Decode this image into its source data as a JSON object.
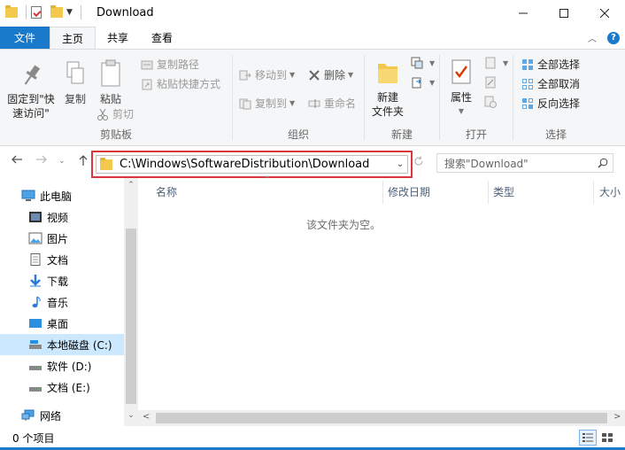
{
  "window": {
    "title": "Download"
  },
  "tabs": {
    "file": "文件",
    "home": "主页",
    "share": "共享",
    "view": "查看"
  },
  "ribbon": {
    "clipboard": {
      "label": "剪贴板",
      "pin": "固定到\"快\n速访问\"",
      "copy": "复制",
      "paste": "粘贴",
      "copy_path": "复制路径",
      "paste_shortcut": "粘贴快捷方式",
      "cut": "剪切"
    },
    "organize": {
      "label": "组织",
      "move_to": "移动到",
      "copy_to": "复制到",
      "delete": "删除",
      "rename": "重命名"
    },
    "new": {
      "label": "新建",
      "new_folder": "新建\n文件夹"
    },
    "open": {
      "label": "打开",
      "properties": "属性"
    },
    "select": {
      "label": "选择",
      "select_all": "全部选择",
      "select_none": "全部取消",
      "invert": "反向选择"
    }
  },
  "address": {
    "path": "C:\\Windows\\SoftwareDistribution\\Download",
    "search_placeholder": "搜索\"Download\""
  },
  "nav": {
    "items": [
      {
        "label": "此电脑",
        "icon": "computer-icon"
      },
      {
        "label": "视频",
        "icon": "video-icon"
      },
      {
        "label": "图片",
        "icon": "pictures-icon"
      },
      {
        "label": "文档",
        "icon": "documents-icon"
      },
      {
        "label": "下载",
        "icon": "download-icon"
      },
      {
        "label": "音乐",
        "icon": "music-icon"
      },
      {
        "label": "桌面",
        "icon": "desktop-icon"
      },
      {
        "label": "本地磁盘 (C:)",
        "icon": "drive-c-icon"
      },
      {
        "label": "软件 (D:)",
        "icon": "drive-icon"
      },
      {
        "label": "文档 (E:)",
        "icon": "drive-icon"
      },
      {
        "label": "网络",
        "icon": "network-icon"
      }
    ]
  },
  "columns": {
    "name": "名称",
    "modified": "修改日期",
    "type": "类型",
    "size": "大小"
  },
  "content": {
    "empty": "该文件夹为空。"
  },
  "status": {
    "count": "0 个项目"
  },
  "colors": {
    "accent": "#1979ca",
    "highlight": "#d9363e",
    "selected": "#cce8ff"
  }
}
